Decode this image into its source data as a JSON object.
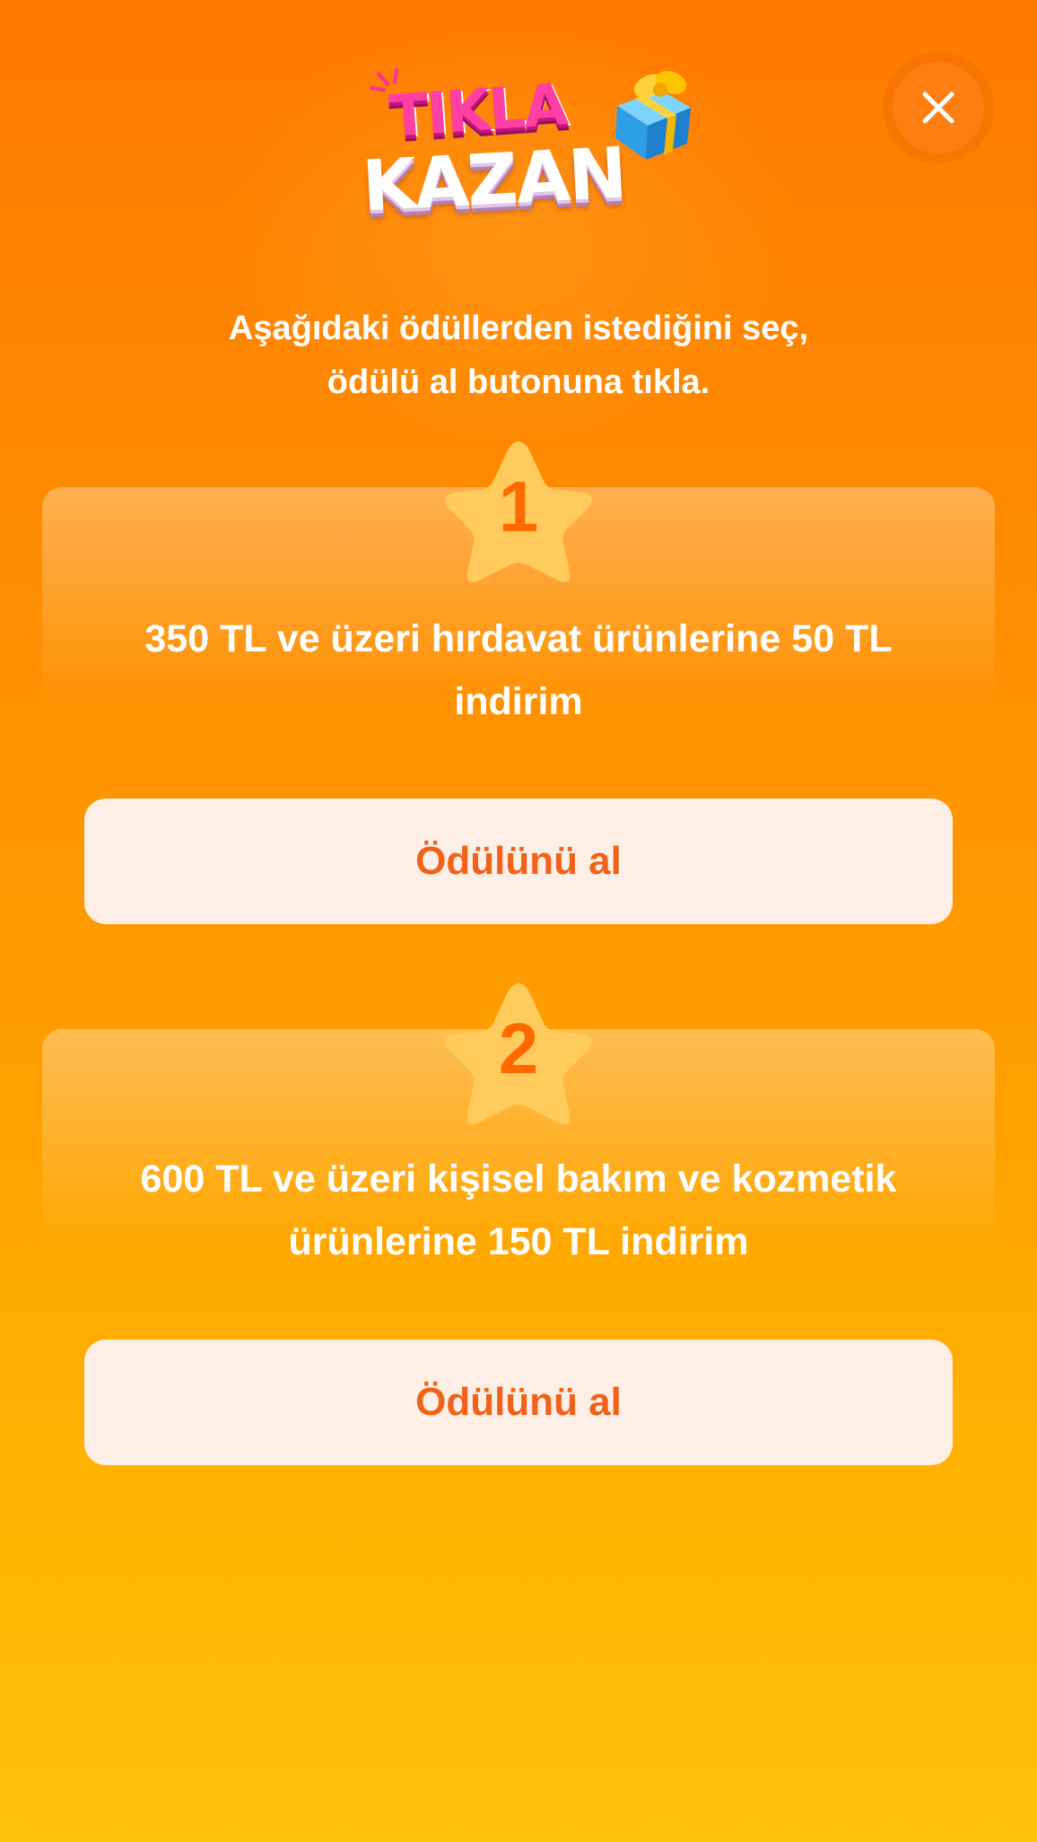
{
  "header": {
    "logo_line1": "TIKLA",
    "logo_line2": "KAZAN",
    "close_icon": "close-icon"
  },
  "instruction": {
    "line1": "Aşağıdaki ödüllerden istediğini seç,",
    "line2": "ödülü al butonuna tıkla."
  },
  "rewards": [
    {
      "number": "1",
      "line1": "350 TL ve üzeri hırdavat ürünlerine 50 TL",
      "line2": "indirim",
      "button_label": "Ödülünü al"
    },
    {
      "number": "2",
      "line1": "600 TL ve üzeri kişisel bakım ve kozmetik",
      "line2": "ürünlerine 150 TL indirim",
      "button_label": "Ödülünü al"
    }
  ],
  "colors": {
    "accent": "#ff6a00",
    "button_bg": "#fdefe6",
    "button_text": "#f0621a",
    "star": "#ffcb5c"
  }
}
